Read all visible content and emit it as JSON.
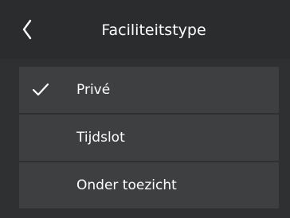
{
  "header": {
    "title": "Faciliteitstype",
    "back_icon": "chevron-left-icon"
  },
  "options": [
    {
      "label": "Privé",
      "selected": true
    },
    {
      "label": "Tijdslot",
      "selected": false
    },
    {
      "label": "Onder toezicht",
      "selected": false
    }
  ],
  "colors": {
    "background": "#2f3031",
    "header_background": "#2b2c2d",
    "item_background": "#3e3f40",
    "text": "#ffffff"
  }
}
